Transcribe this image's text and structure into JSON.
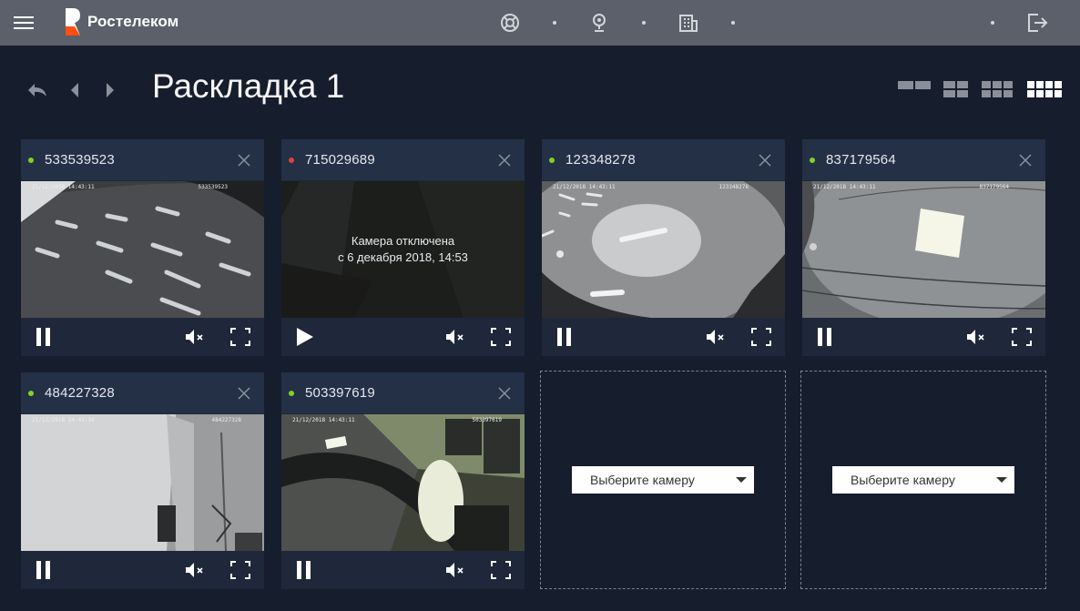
{
  "brand": {
    "name": "Ростелеком"
  },
  "toolbar": {
    "title": "Раскладка 1"
  },
  "colors": {
    "online": "#7ed321",
    "offline": "#e0413b",
    "topbar": "#5b606b",
    "background": "#161d2c"
  },
  "cameras": [
    {
      "id": "533539523",
      "status": "online",
      "overlay_left": "21/12/2018 14:43:11",
      "overlay_right": "533539523"
    },
    {
      "id": "715029689",
      "status": "offline",
      "offline_line1": "Камера отключена",
      "offline_line2": "с  6 декабря 2018, 14:53"
    },
    {
      "id": "123348278",
      "status": "online",
      "overlay_left": "21/12/2018 14:43:11",
      "overlay_right": "123348278"
    },
    {
      "id": "837179564",
      "status": "online",
      "overlay_left": "21/12/2018 14:43:11",
      "overlay_right": "837179564"
    },
    {
      "id": "484227328",
      "status": "online",
      "overlay_left": "21/12/2018 14:43:10",
      "overlay_right": "484227328"
    },
    {
      "id": "503397619",
      "status": "online",
      "overlay_left": "21/12/2018 14:43:11",
      "overlay_right": "503397619"
    }
  ],
  "empty_slots": [
    {
      "select_label": "Выберите камеру"
    },
    {
      "select_label": "Выберите камеру"
    }
  ],
  "icons": {
    "menu": "hamburger-icon",
    "support": "lifebuoy-icon",
    "camera": "webcam-icon",
    "building": "building-icon",
    "logout": "logout-icon",
    "back": "undo-arrow-icon",
    "prev": "chevron-left-icon",
    "next": "chevron-right-icon",
    "pause": "pause-icon",
    "play": "play-icon",
    "mute": "mute-icon",
    "fullscreen": "fullscreen-icon",
    "close": "close-icon"
  }
}
